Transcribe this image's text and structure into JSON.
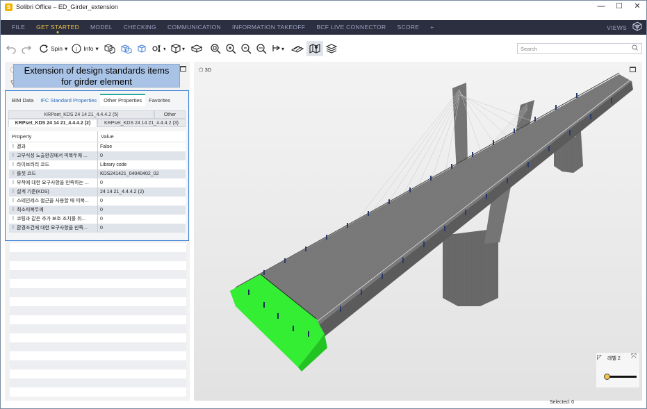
{
  "window": {
    "title": "Solibri Office – ED_Girder_extension",
    "app_icon": "S",
    "minimize": "—",
    "maximize": "☐",
    "close": "✕"
  },
  "menu": {
    "items": [
      {
        "label": "FILE",
        "active": false
      },
      {
        "label": "GET STARTED",
        "active": true
      },
      {
        "label": "MODEL",
        "active": false
      },
      {
        "label": "CHECKING",
        "active": false
      },
      {
        "label": "COMMUNICATION",
        "active": false
      },
      {
        "label": "INFORMATION TAKEOFF",
        "active": false
      },
      {
        "label": "BCF LIVE CONNECTOR",
        "active": false
      },
      {
        "label": "SCORE",
        "active": false
      },
      {
        "label": "+",
        "active": false
      }
    ],
    "views_label": "VIEWS",
    "accent_color": "#f0c24a",
    "bg_color": "#2b2f3f"
  },
  "toolbar": {
    "spin_label": "Spin",
    "info_label": "Info",
    "search_placeholder": "Search"
  },
  "callout": {
    "line1": "Extension of design standards items",
    "line2": "for girder element"
  },
  "properties": {
    "tabs": [
      {
        "label": "BIM Data",
        "style": "normal"
      },
      {
        "label": "IFC Standard Properties",
        "style": "link"
      },
      {
        "label": "Other Properties",
        "style": "active"
      },
      {
        "label": "Favorites",
        "style": "normal"
      }
    ],
    "subtabs": {
      "row1_a": "KRPset_KDS 24 14 21_4.4.4.2 (5)",
      "row1_b": "Other",
      "row2_a": "KRPset_KDS 24 14 21_4.4.4.2 (2)",
      "row2_b": "KRPset_KDS 24 14 21_4.4.4.2 (3)"
    },
    "header": {
      "property": "Property",
      "value": "Value"
    },
    "rows": [
      {
        "property": "결과",
        "value": "False"
      },
      {
        "property": "고부식성 노출환경에서 피복두께 ...",
        "value": "0"
      },
      {
        "property": "라이브러리 코드",
        "value": "Library code"
      },
      {
        "property": "룰셋 코드",
        "value": "KDS241421_04040402_02"
      },
      {
        "property": "부착에 대한 요구사항을 만족하는 ...",
        "value": "0"
      },
      {
        "property": "설계 기준(KDS)",
        "value": "24 14 21_4.4.4.2 (2)"
      },
      {
        "property": "스테인레스 철근을 사용할 때 피복...",
        "value": "0"
      },
      {
        "property": "최소피복두께",
        "value": "0"
      },
      {
        "property": "코팅과 같은 추가 보호 조치를 취...",
        "value": "0"
      },
      {
        "property": "환경조건에 대한 요구사항을 만족...",
        "value": "0"
      }
    ]
  },
  "viewport": {
    "label": "3D",
    "highlight_color": "#33ee33"
  },
  "level": {
    "label": "레벨 2",
    "slider_value": 0
  },
  "status": {
    "selected": "Selected: 0"
  }
}
